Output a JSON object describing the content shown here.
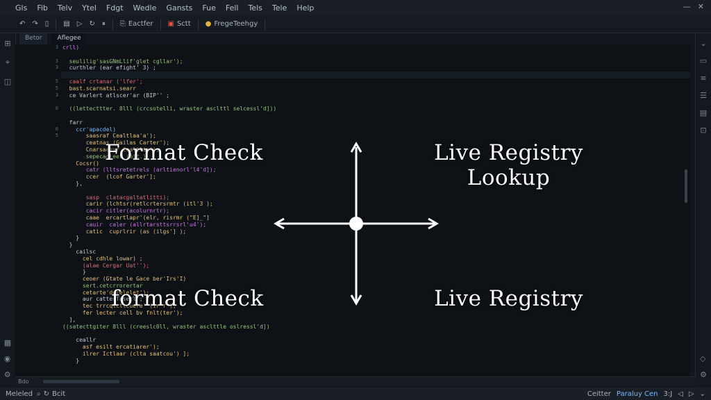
{
  "menu": [
    "Gls",
    "Fib",
    "Telv",
    "Ytel",
    "Fdgt",
    "Wedle",
    "Gansts",
    "Fue",
    "Fell",
    "Tels",
    "Tele",
    "Help"
  ],
  "toolbar": {
    "editor_label": "Eactfer",
    "run_label": "Sctt",
    "format_label": "FregeTeehgy"
  },
  "tabs": [
    "Betor",
    "Aflegee"
  ],
  "gutter_numbers": [
    "3",
    "",
    "3",
    "3",
    "",
    "5",
    "5",
    "3",
    "",
    "0",
    "",
    "",
    "0",
    "5",
    "",
    "",
    "",
    "",
    "",
    "",
    "",
    "",
    "",
    "",
    "",
    "",
    "",
    "",
    "",
    "",
    "",
    "",
    "",
    "",
    "",
    "",
    "",
    "",
    "",
    "",
    "",
    "",
    "",
    "",
    "",
    "",
    "",
    "",
    "",
    ""
  ],
  "code_lines": [
    {
      "c": "p",
      "text": "crll)"
    },
    {
      "c": "t",
      "text": ""
    },
    {
      "c": "f",
      "text": "  seulilig'sasGNmLlif'glet cgllar');"
    },
    {
      "c": "t",
      "text": "  curthler (ear efight' 3) ;"
    },
    {
      "c": "t",
      "text": ""
    },
    {
      "c": "o",
      "text": "  caalf crtanar ('lfer';"
    },
    {
      "c": "s",
      "text": "  bast.scarnatsi.searr"
    },
    {
      "c": "t",
      "text": "  ce Varlert atlscer'ar (BIP'' ;"
    },
    {
      "c": "t",
      "text": ""
    },
    {
      "c": "f",
      "text": "  ((lettecttter. 8lll (crcsotelli, wraster asclttl selcessl'd]))"
    },
    {
      "c": "t",
      "text": ""
    },
    {
      "c": "t",
      "text": "  farr"
    },
    {
      "c": "k",
      "text": "    ccr'apacdel)"
    },
    {
      "c": "s",
      "text": "       saasraf Cealtlaa'a');"
    },
    {
      "c": "s",
      "text": "       ceatnas (Gailas Carter');"
    },
    {
      "c": "s",
      "text": "       Cnarsaaeyr Cealtlia');"
    },
    {
      "c": "f",
      "text": "       sepecaqleer (ait.)"
    },
    {
      "c": "s",
      "text": "    Cocsr()"
    },
    {
      "c": "p",
      "text": "       catr (lltsretetrels (arltienorl'l4'd]);"
    },
    {
      "c": "s",
      "text": "       ccer  (lcof Garter'];"
    },
    {
      "c": "t",
      "text": "    },"
    },
    {
      "c": "t",
      "text": ""
    },
    {
      "c": "o",
      "text": "       sasp  clatacgaltatlitti);"
    },
    {
      "c": "s",
      "text": "       carir (lchtsr(retlcrtersrmtr (itl'3 );"
    },
    {
      "c": "p",
      "text": "       cacir citler(acolurnrtr);"
    },
    {
      "c": "s",
      "text": "       caae  ercartlapr'(elr, risrmr (\"E]_\"]"
    },
    {
      "c": "p",
      "text": "       cauir  caler (allrtarsttsrrsrl'u4');"
    },
    {
      "c": "s",
      "text": "       catic  cuprlrir (as (ilgs'] );"
    },
    {
      "c": "t",
      "text": "    }"
    },
    {
      "c": "t",
      "text": "  }"
    },
    {
      "c": "t",
      "text": "    cailsc"
    },
    {
      "c": "s",
      "text": "      cel cdhle lowar) ;"
    },
    {
      "c": "o",
      "text": "      (alae Cergar Uat'');"
    },
    {
      "c": "t",
      "text": "      }"
    },
    {
      "c": "s",
      "text": "      ceoer (Gtate le Gace ber'Irs'I)"
    },
    {
      "c": "f",
      "text": "      sert.cetcrrorertar"
    },
    {
      "c": "s",
      "text": "      cetarte'ddrelelet');"
    },
    {
      "c": "t",
      "text": "      aur catterTaserl';"
    },
    {
      "c": "s",
      "text": "      tec trrcqlctlcuere' (ir'r');"
    },
    {
      "c": "s",
      "text": "      fer lecter cell bv fnlt(ter');"
    },
    {
      "c": "t",
      "text": "  ],"
    },
    {
      "c": "f",
      "text": "((satecttgiter 8lll (creeslc0ll, wraster asclttle oslressl'd])"
    },
    {
      "c": "t",
      "text": ""
    },
    {
      "c": "t",
      "text": "    ceallr"
    },
    {
      "c": "s",
      "text": "      asf esilt ercatiarer');"
    },
    {
      "c": "s",
      "text": "      ilrer Ictlaar (clta saatcou') ];"
    },
    {
      "c": "t",
      "text": "    }"
    }
  ],
  "labels": {
    "top_left": "Format Check",
    "top_right": "Live Registry Lookup",
    "bottom_left": "format Check",
    "bottom_right": "Live Registry"
  },
  "hscroll_label": "Bdo",
  "status": {
    "left": "Meleled",
    "branch": "Bcit",
    "mode": "Ceitter",
    "highlight": "Paraluy Cen",
    "position": "3:J"
  }
}
